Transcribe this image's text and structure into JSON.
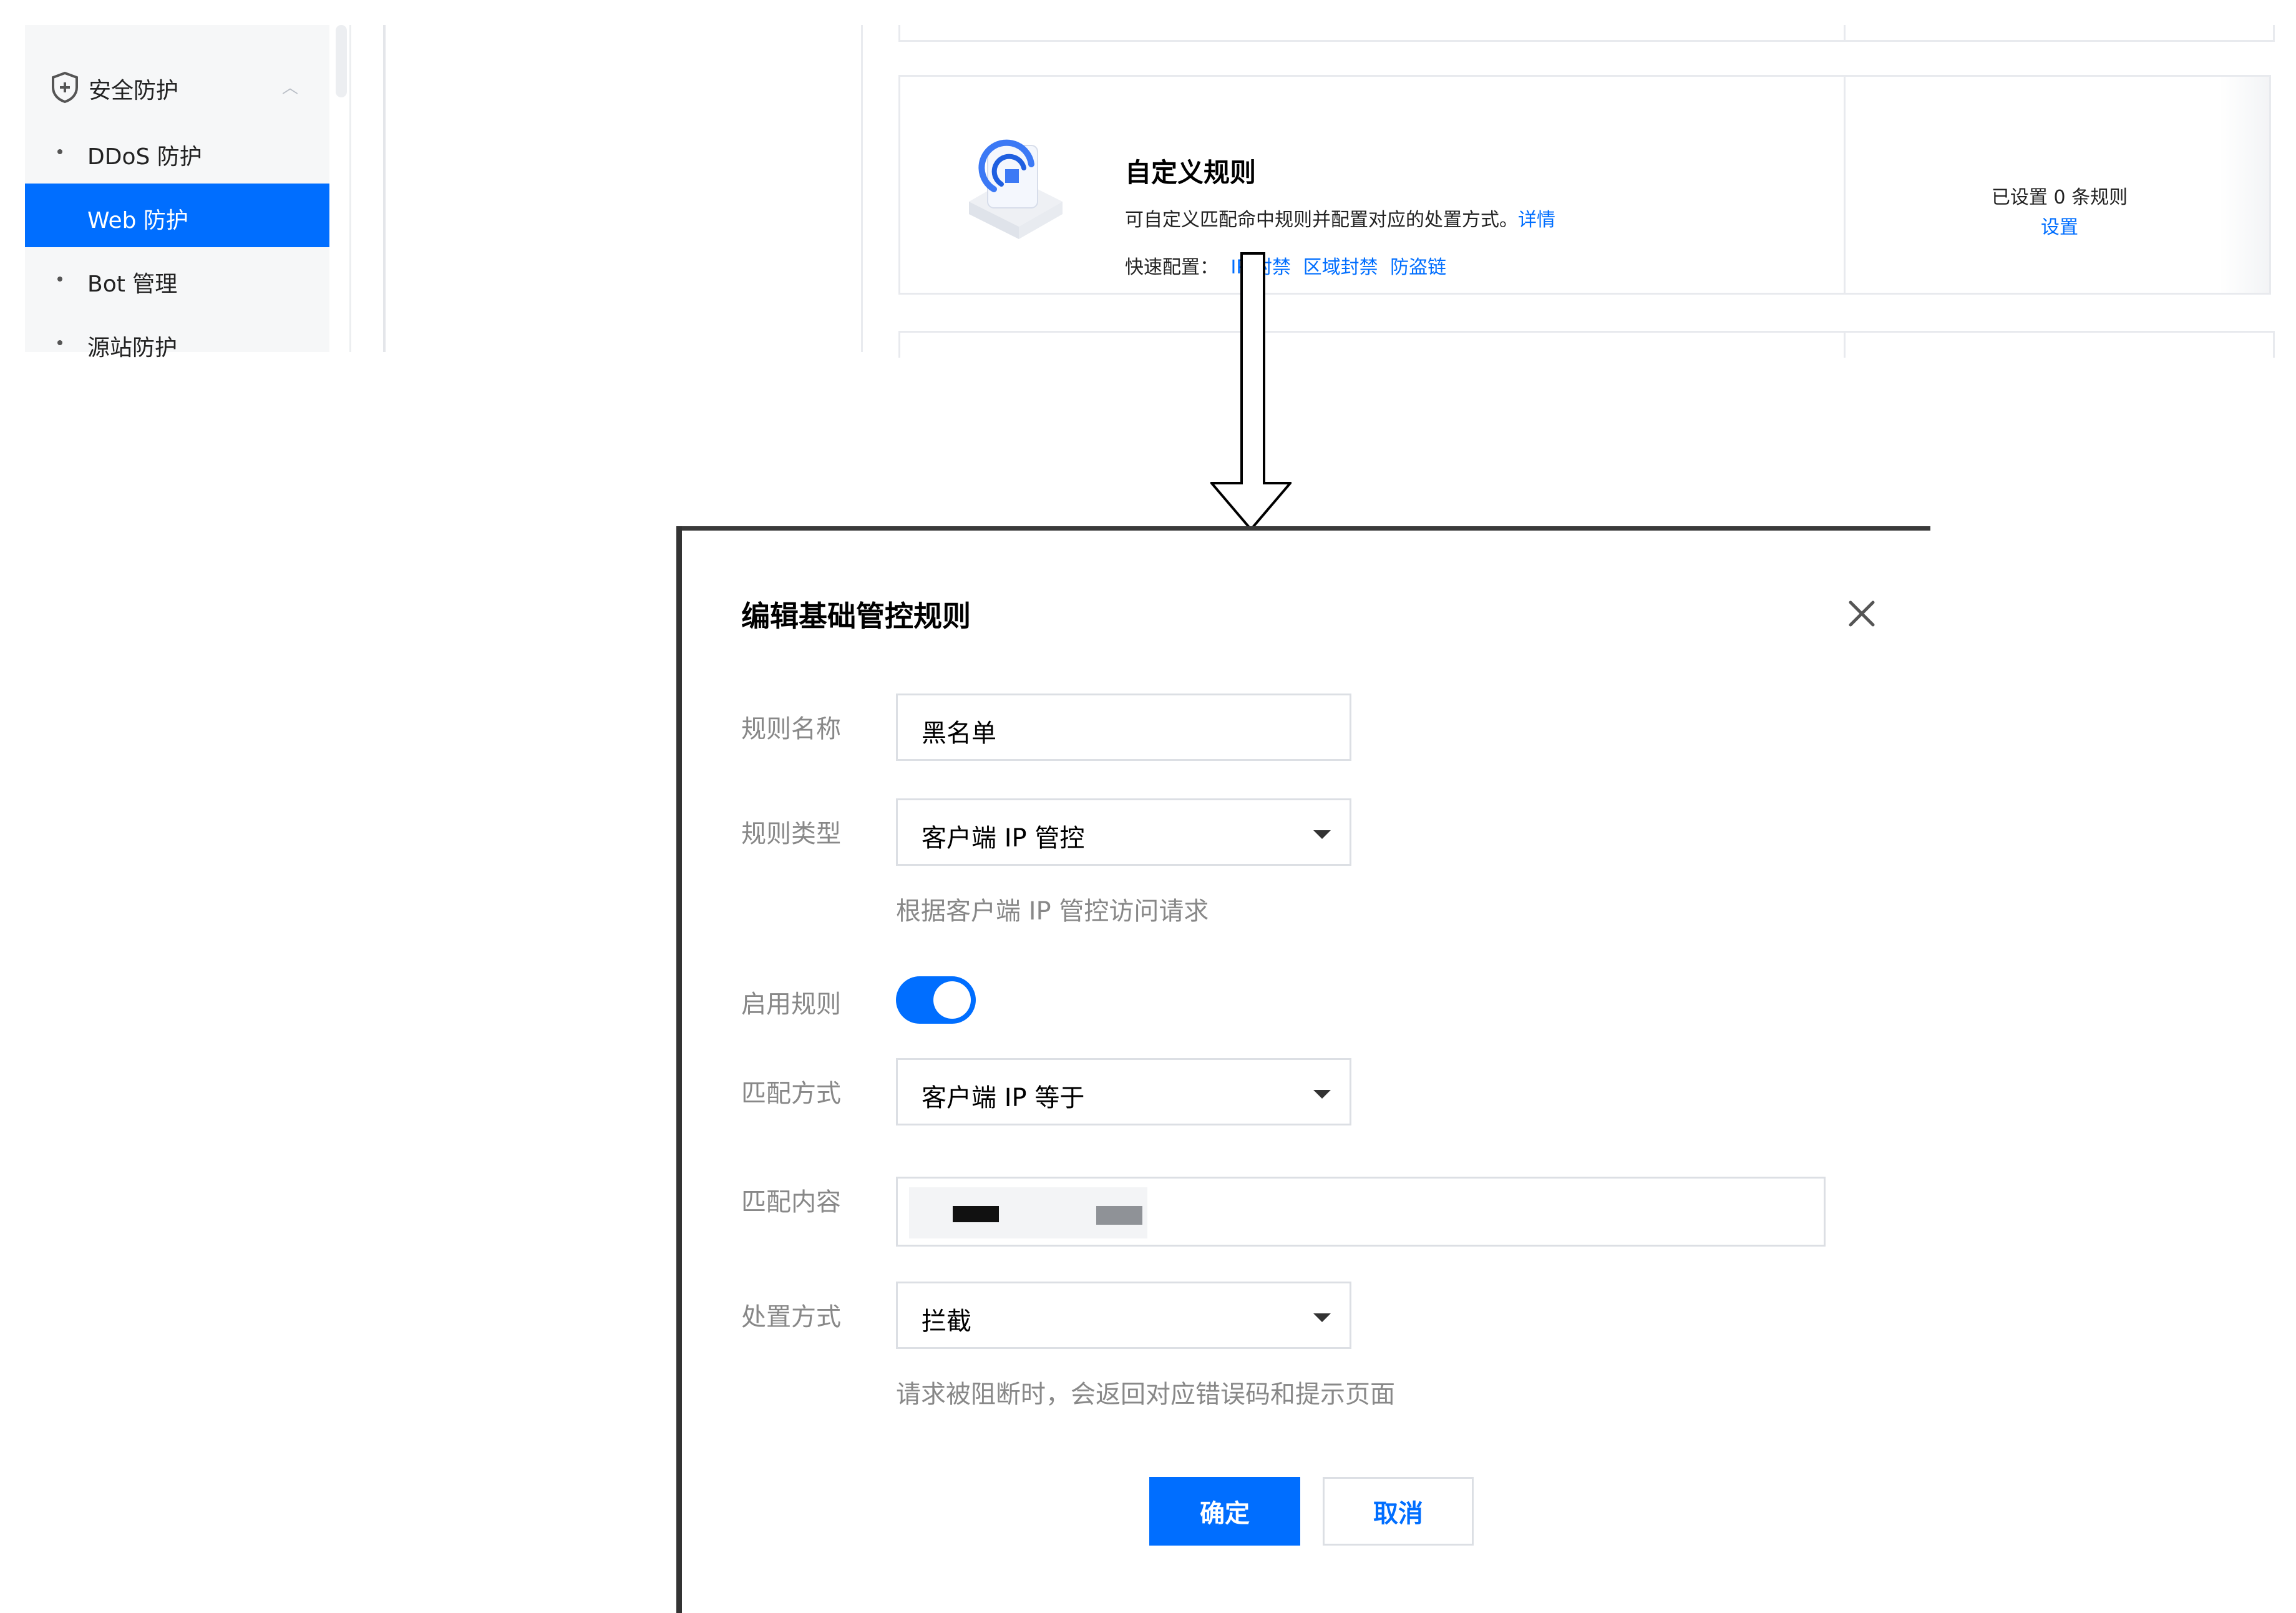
{
  "sidebar": {
    "group_label": "安全防护",
    "items": [
      {
        "label": "DDoS 防护",
        "active": false
      },
      {
        "label": "Web 防护",
        "active": true
      },
      {
        "label": "Bot 管理",
        "active": false
      },
      {
        "label": "源站防护",
        "active": false
      }
    ]
  },
  "rule_card": {
    "title": "自定义规则",
    "description": "可自定义匹配命中规则并配置对应的处置方式。",
    "detail_link": "详情",
    "quick_config_label": "快速配置：",
    "quick_links": [
      "IP 封禁",
      "区域封禁",
      "防盗链"
    ],
    "count_text": "已设置 0 条规则",
    "set_link": "设置"
  },
  "modal": {
    "title": "编辑基础管控规则",
    "fields": {
      "rule_name": {
        "label": "规则名称",
        "value": "黑名单"
      },
      "rule_type": {
        "label": "规则类型",
        "value": "客户端 IP 管控",
        "hint": "根据客户端 IP 管控访问请求"
      },
      "enable": {
        "label": "启用规则",
        "enabled": true
      },
      "match_method": {
        "label": "匹配方式",
        "value": "客户端 IP 等于"
      },
      "match_content": {
        "label": "匹配内容"
      },
      "action": {
        "label": "处置方式",
        "value": "拦截",
        "hint": "请求被阻断时，会返回对应错误码和提示页面"
      }
    },
    "buttons": {
      "confirm": "确定",
      "cancel": "取消"
    }
  },
  "colors": {
    "accent": "#006eff",
    "label_gray": "#888888",
    "border": "#dcdfe4",
    "sidebar_bg": "#f6f7f8"
  },
  "icons": [
    "shield-icon",
    "chevron-up-icon",
    "close-icon",
    "chevron-down-icon",
    "down-arrow-icon"
  ]
}
